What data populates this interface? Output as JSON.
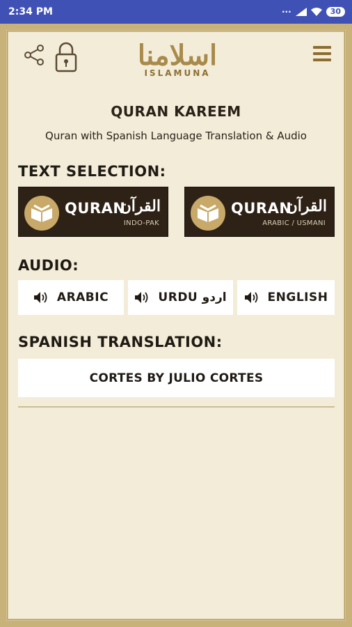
{
  "status_bar": {
    "time": "2:34 PM",
    "battery": "30"
  },
  "header": {
    "logo_arabic": "اسلامنا",
    "logo_english": "ISLAMUNA"
  },
  "page": {
    "title": "QURAN KAREEM",
    "subtitle": "Quran with Spanish Language Translation & Audio"
  },
  "text_selection": {
    "heading": "TEXT SELECTION:",
    "options": [
      {
        "label": "QURAN",
        "arabic": "القرآن",
        "sub": "INDO-PAK"
      },
      {
        "label": "QURAN",
        "arabic": "القرآن",
        "sub": "ARABIC / USMANI"
      }
    ]
  },
  "audio": {
    "heading": "AUDIO:",
    "options": [
      {
        "label": "ARABIC"
      },
      {
        "label": "URDU اردو"
      },
      {
        "label": "ENGLISH"
      }
    ]
  },
  "translation": {
    "heading": "SPANISH TRANSLATION:",
    "option": "CORTES BY JULIO CORTES"
  },
  "colors": {
    "status_bar": "#3f51b5",
    "background": "#f3ecd9",
    "button_dark": "#2e2115",
    "gold": "#c8a96a"
  }
}
